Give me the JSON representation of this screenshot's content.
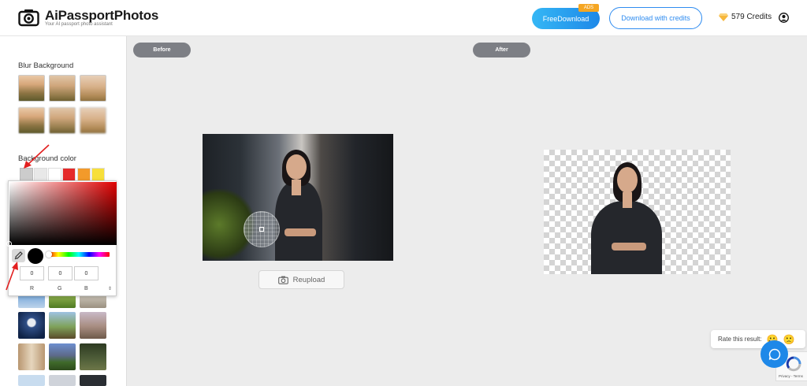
{
  "header": {
    "app_title": "AiPassportPhotos",
    "app_subtitle": "Your AI passport photo assistant",
    "free_download_label": "FreeDownload",
    "ads_badge": "ADS",
    "download_credits_label": "Download with credits",
    "credits_text": "579 Credits"
  },
  "sidebar": {
    "blur_title": "Blur Background",
    "bg_color_title": "Background color",
    "swatches": [
      "#e8e8e8",
      "#ffffff",
      "#e52a2a",
      "#f39a2a",
      "#f7df3a"
    ]
  },
  "color_picker": {
    "r_value": "0",
    "g_value": "0",
    "b_value": "0",
    "r_label": "R",
    "g_label": "G",
    "b_label": "B",
    "mode_arrows": "⇕"
  },
  "main": {
    "before_label": "Before",
    "after_label": "After",
    "reupload_label": "Reupload"
  },
  "feedback": {
    "rate_label": "Rate this result:",
    "emoji_happy": "😀",
    "emoji_sad": "🙁"
  },
  "recaptcha": {
    "text": "Privacy - Terms"
  },
  "colors": {
    "accent": "#1e88e8",
    "pill": "#7d7f85",
    "ads": "#f5a623"
  }
}
